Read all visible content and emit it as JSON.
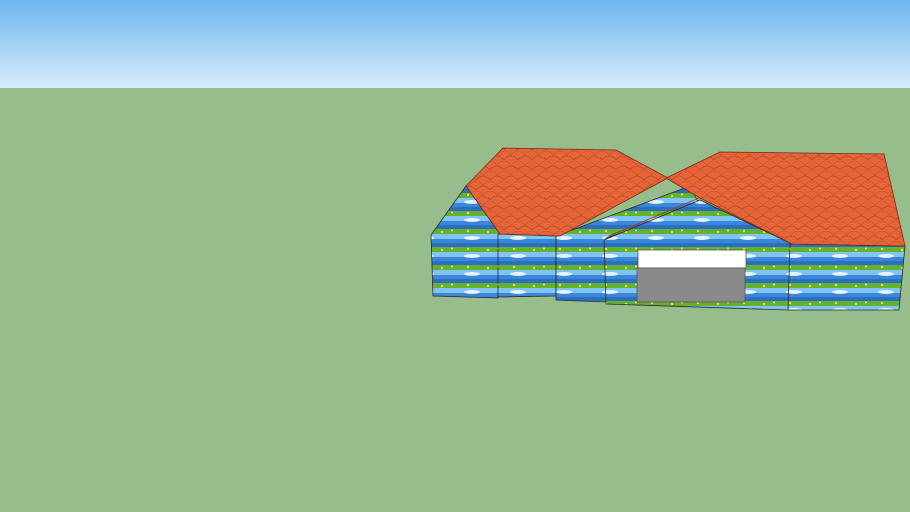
{
  "colors": {
    "sky_top": "#6cb6ef",
    "sky_bottom": "#d9ecfb",
    "ground": "#98bd8c",
    "roof": "#e5643a",
    "roof_dark": "#a8401e",
    "roof_edge": "#7a2a10",
    "wall_sky": "#3a86d8",
    "wall_grass": "#5aa72c",
    "door": "#8a8a8a",
    "door_header": "#ffffff"
  },
  "scene": {
    "objects": [
      "house",
      "roof",
      "textured-walls",
      "garage-door"
    ]
  }
}
